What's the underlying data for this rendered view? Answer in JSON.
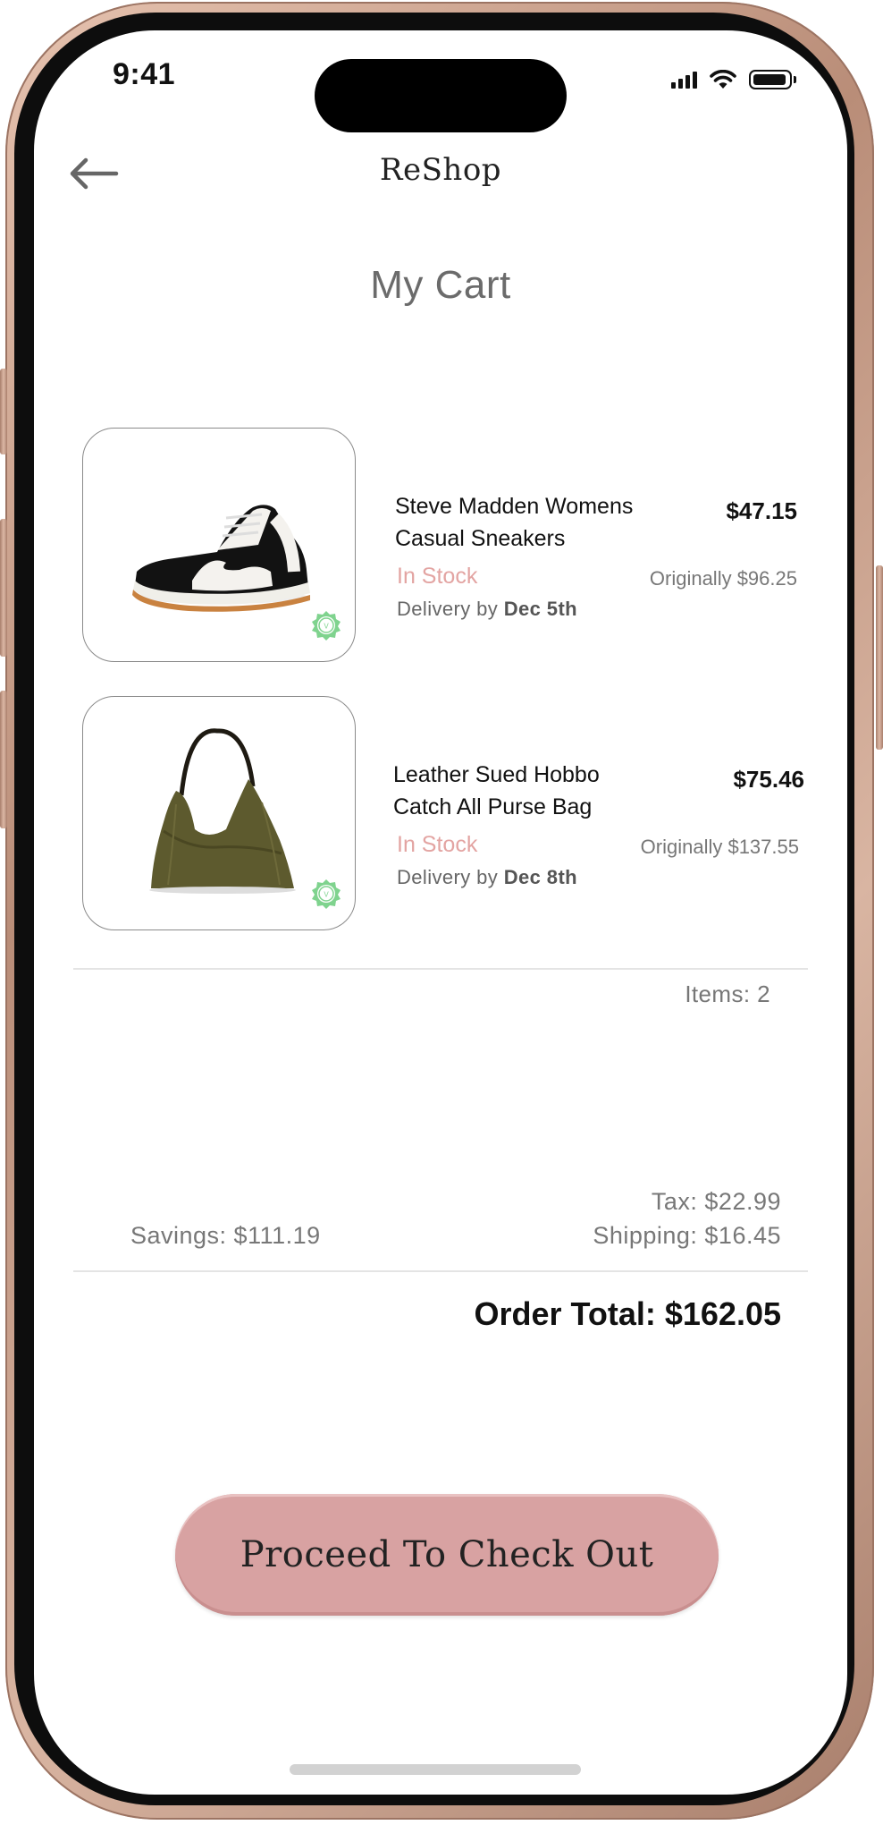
{
  "status_bar": {
    "time": "9:41"
  },
  "header": {
    "brand": "ReShop",
    "title": "My Cart"
  },
  "cart": {
    "items": [
      {
        "name_line1": "Steve Madden Womens",
        "name_line2": "Casual Sneakers",
        "price": "$47.15",
        "stock": "In Stock",
        "original": "Originally $96.25",
        "delivery_prefix": "Delivery by ",
        "delivery_date": "Dec 5th",
        "image_icon": "sneaker-image"
      },
      {
        "name_line1": "Leather Sued Hobbo",
        "name_line2": "Catch All Purse Bag",
        "price": "$75.46",
        "stock": "In Stock",
        "original": "Originally $137.55",
        "delivery_prefix": "Delivery by ",
        "delivery_date": "Dec 8th",
        "image_icon": "handbag-image"
      }
    ]
  },
  "summary": {
    "items_count": "Items: 2",
    "tax": "Tax:  $22.99",
    "shipping": "Shipping:  $16.45",
    "savings": "Savings:  $111.19",
    "order_total": "Order Total: $162.05"
  },
  "actions": {
    "checkout_label": "Proceed To Check Out"
  },
  "colors": {
    "accent": "#d8a2a2",
    "in_stock": "#e3a4a2",
    "badge": "#7fd38e"
  }
}
